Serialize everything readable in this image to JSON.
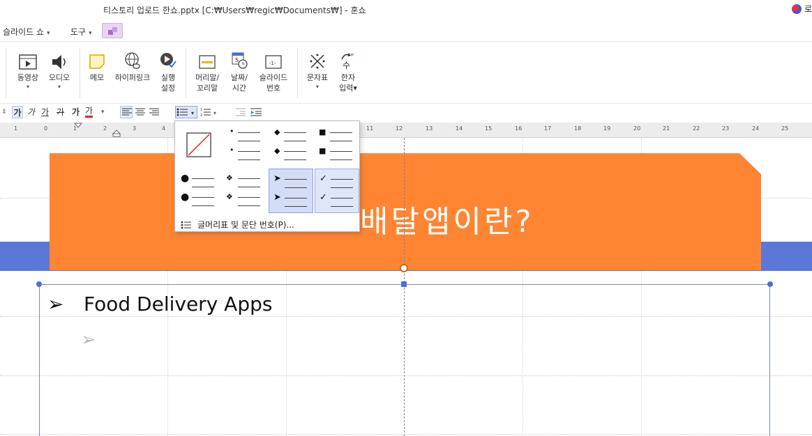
{
  "window": {
    "title": "티스토리 업로드 한쇼.pptx [C:₩Users₩regic₩Documents₩] - 훈쇼",
    "login_label": "로"
  },
  "menubar": {
    "slideshow_label": "슬라이드 쇼",
    "tools_label": "도구",
    "caret": "▾"
  },
  "ribbon": {
    "video": {
      "label": "동영상",
      "dd": "▾"
    },
    "audio": {
      "label": "오디오",
      "dd": "▾"
    },
    "memo": {
      "label": "메모"
    },
    "hyperlink": {
      "label": "하이퍼링크"
    },
    "run_settings": {
      "line1": "실행",
      "line2": "설정"
    },
    "header_footer": {
      "line1": "머리말/",
      "line2": "꼬리말"
    },
    "date_time": {
      "line1": "날짜/",
      "line2": "시간"
    },
    "slide_number": {
      "line1": "슬라이드",
      "line2": "번호"
    },
    "symbol": {
      "label": "문자표",
      "dd": "▾"
    },
    "hanja": {
      "line1": "한자",
      "line2": "입력▾"
    }
  },
  "format_bar": {
    "bold": "가",
    "italic": "가",
    "underline": "가",
    "strike": "가",
    "outline": "가",
    "color": "가"
  },
  "ruler": {
    "numbers": [
      "1",
      "0",
      "1",
      "2",
      "3",
      "4",
      "11",
      "12",
      "13",
      "14",
      "15",
      "16",
      "17",
      "18",
      "19",
      "20",
      "21",
      "22",
      "23",
      "24",
      "25"
    ]
  },
  "slide": {
    "title": "배달앱이란?",
    "bullet1_text": "Food Delivery Apps",
    "bullet_marker": "➢",
    "colors": {
      "orange": "#ff8533",
      "blue": "#5b78d6"
    }
  },
  "bullet_popup": {
    "footer_label": "글머리표 및 문단 번호(P)...",
    "options": [
      "none",
      "small-dot",
      "diamond",
      "square",
      "large-dot",
      "four-diamond",
      "arrow",
      "checkmark"
    ],
    "selected": "arrow"
  }
}
